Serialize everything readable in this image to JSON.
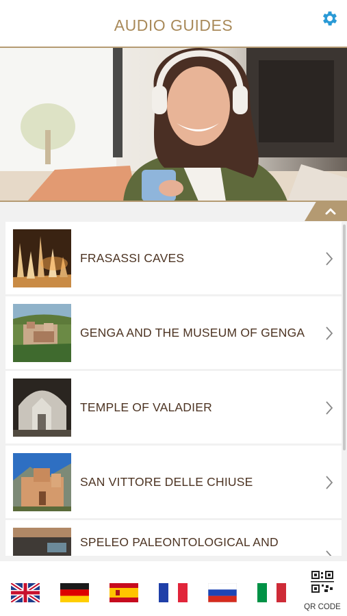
{
  "header": {
    "title": "AUDIO GUIDES",
    "settings_icon": "gear-icon"
  },
  "hero": {
    "image": "woman-with-headphones-and-phone",
    "collapse_icon": "chevron-up-icon"
  },
  "guides": [
    {
      "label": "FRASASSI CAVES",
      "thumb": "cave-stalagmites"
    },
    {
      "label": "GENGA AND THE MUSEUM OF GENGA",
      "thumb": "hill-village"
    },
    {
      "label": "TEMPLE OF VALADIER",
      "thumb": "temple-in-cave"
    },
    {
      "label": "SAN VITTORE DELLE CHIUSE",
      "thumb": "stone-abbey"
    },
    {
      "label": "SPELEO PALEONTOLOGICAL AND",
      "thumb": "museum-interior"
    }
  ],
  "footer": {
    "languages": [
      {
        "code": "en",
        "icon": "uk-flag-icon"
      },
      {
        "code": "de",
        "icon": "germany-flag-icon"
      },
      {
        "code": "es",
        "icon": "spain-flag-icon"
      },
      {
        "code": "fr",
        "icon": "france-flag-icon"
      },
      {
        "code": "ru",
        "icon": "russia-flag-icon"
      },
      {
        "code": "it",
        "icon": "italy-flag-icon"
      }
    ],
    "qr_label": "QR CODE"
  },
  "colors": {
    "accent": "#a98a5a",
    "settings": "#2a9ad6",
    "item_text": "#4d3423"
  }
}
